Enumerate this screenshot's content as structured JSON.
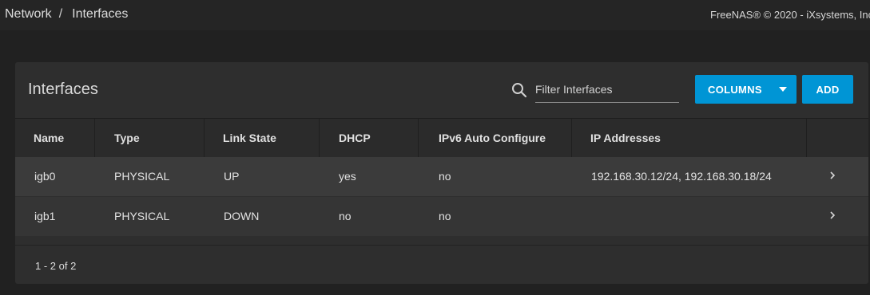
{
  "breadcrumb": {
    "items": [
      "Network",
      "Interfaces"
    ],
    "separator": "/"
  },
  "copyright": "FreeNAS® © 2020 - iXsystems, Inc",
  "card": {
    "title": "Interfaces",
    "search": {
      "placeholder": "Filter Interfaces",
      "value": "",
      "icon": "search-icon"
    },
    "columns_button": "COLUMNS",
    "add_button": "ADD"
  },
  "table": {
    "headers": [
      "Name",
      "Type",
      "Link State",
      "DHCP",
      "IPv6 Auto Configure",
      "IP Addresses"
    ],
    "rows": [
      {
        "name": "igb0",
        "type": "PHYSICAL",
        "link_state": "UP",
        "dhcp": "yes",
        "ipv6": "no",
        "ip": "192.168.30.12/24, 192.168.30.18/24"
      },
      {
        "name": "igb1",
        "type": "PHYSICAL",
        "link_state": "DOWN",
        "dhcp": "no",
        "ipv6": "no",
        "ip": ""
      }
    ]
  },
  "pagination": "1 - 2 of 2",
  "colors": {
    "background": "#212121",
    "card": "#2e2e2e",
    "accent": "#0095d5"
  }
}
